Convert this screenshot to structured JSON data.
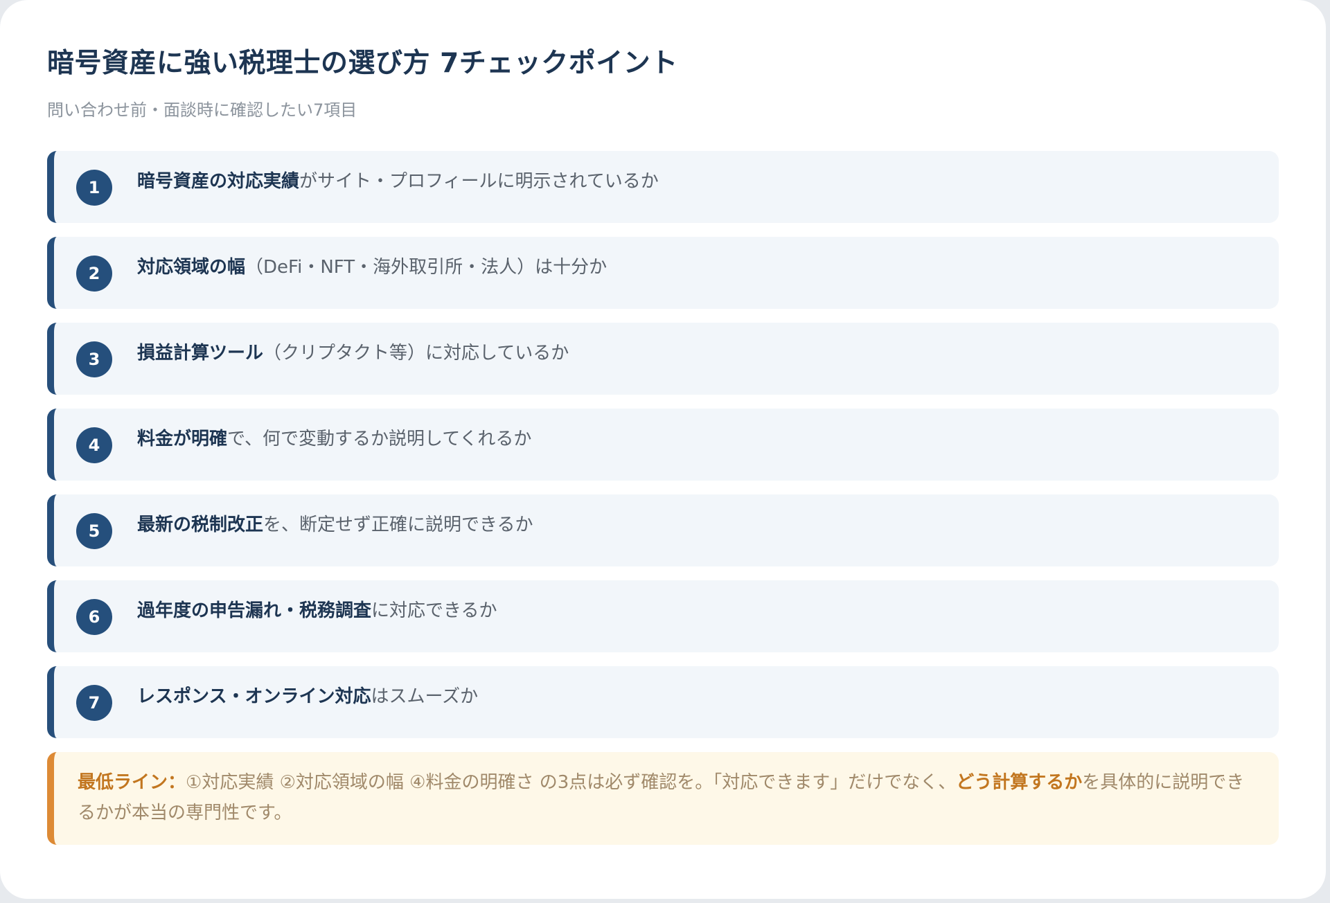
{
  "header": {
    "title": "暗号資産に強い税理士の選び方 7チェックポイント",
    "subtitle": "問い合わせ前・面談時に確認したい7項目"
  },
  "checklist": [
    {
      "number": "1",
      "bold": "暗号資産の対応実績",
      "rest": "がサイト・プロフィールに明示されているか"
    },
    {
      "number": "2",
      "bold": "対応領域の幅",
      "rest": "（DeFi・NFT・海外取引所・法人）は十分か"
    },
    {
      "number": "3",
      "bold": "損益計算ツール",
      "rest": "（クリプタクト等）に対応しているか"
    },
    {
      "number": "4",
      "bold": "料金が明確",
      "rest": "で、何で変動するか説明してくれるか"
    },
    {
      "number": "5",
      "bold": "最新の税制改正",
      "rest": "を、断定せず正確に説明できるか"
    },
    {
      "number": "6",
      "bold": "過年度の申告漏れ・税務調査",
      "rest": "に対応できるか"
    },
    {
      "number": "7",
      "bold": "レスポンス・オンライン対応",
      "rest": "はスムーズか"
    }
  ],
  "note": {
    "label": "最低ライン：",
    "text_before": "①対応実績 ②対応領域の幅 ④料金の明確さ の3点は必ず確認を。「対応できます」だけでなく、",
    "emphasis": "どう計算するか",
    "text_after": "を具体的に説明できるかが本当の専門性です。"
  },
  "colors": {
    "accent_navy": "#254f7c",
    "title_navy": "#1d3552",
    "item_background": "#f2f6fa",
    "note_border": "#dd8a35",
    "note_background": "#fef8e8",
    "note_emphasis": "#c2761f"
  }
}
